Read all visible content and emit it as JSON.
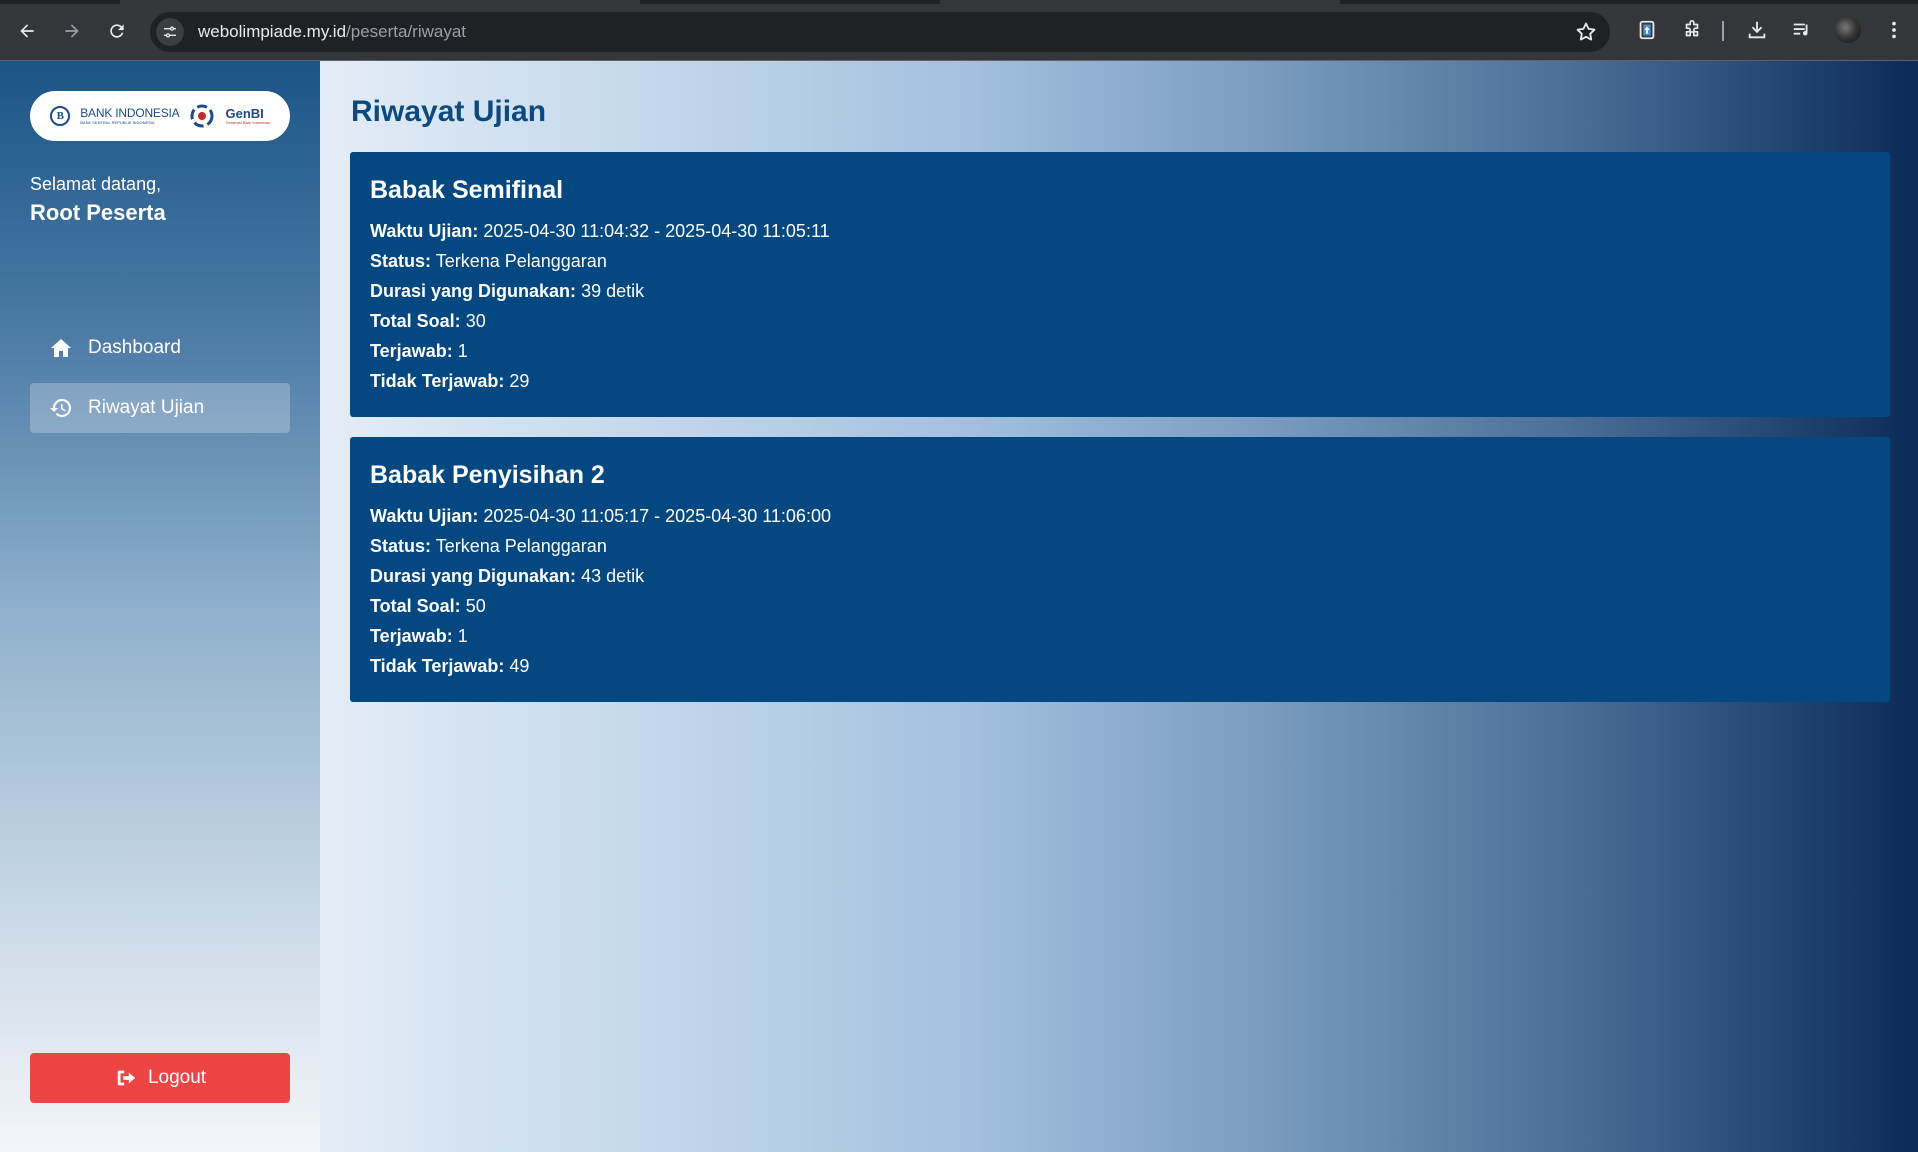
{
  "browser": {
    "url_host": "webolimpiade.my.id",
    "url_path": "/peserta/riwayat"
  },
  "sidebar": {
    "logo": {
      "bi_name": "BANK INDONESIA",
      "bi_sub": "BANK SENTRAL REPUBLIK INDONESIA",
      "genbi_name": "GenBI",
      "genbi_sub": "Generasi Baru Indonesia"
    },
    "welcome": "Selamat datang,",
    "username": "Root Peserta",
    "items": [
      {
        "label": "Dashboard",
        "icon": "home-icon",
        "active": false
      },
      {
        "label": "Riwayat Ujian",
        "icon": "history-icon",
        "active": true
      }
    ],
    "logout_label": "Logout"
  },
  "main": {
    "title": "Riwayat Ujian",
    "labels": {
      "waktu": "Waktu Ujian:",
      "status": "Status:",
      "durasi": "Durasi yang Digunakan:",
      "total": "Total Soal:",
      "terjawab": "Terjawab:",
      "tidak": "Tidak Terjawab:"
    },
    "exams": [
      {
        "name": "Babak Semifinal",
        "waktu": "2025-04-30 11:04:32 - 2025-04-30 11:05:11",
        "status": "Terkena Pelanggaran",
        "durasi": "39 detik",
        "total": "30",
        "terjawab": "1",
        "tidak": "29"
      },
      {
        "name": "Babak Penyisihan 2",
        "waktu": "2025-04-30 11:05:17 - 2025-04-30 11:06:00",
        "status": "Terkena Pelanggaran",
        "durasi": "43 detik",
        "total": "50",
        "terjawab": "1",
        "tidak": "49"
      }
    ]
  },
  "colors": {
    "card_bg": "#044882",
    "title": "#0b4a80",
    "logout": "#ef4444"
  }
}
